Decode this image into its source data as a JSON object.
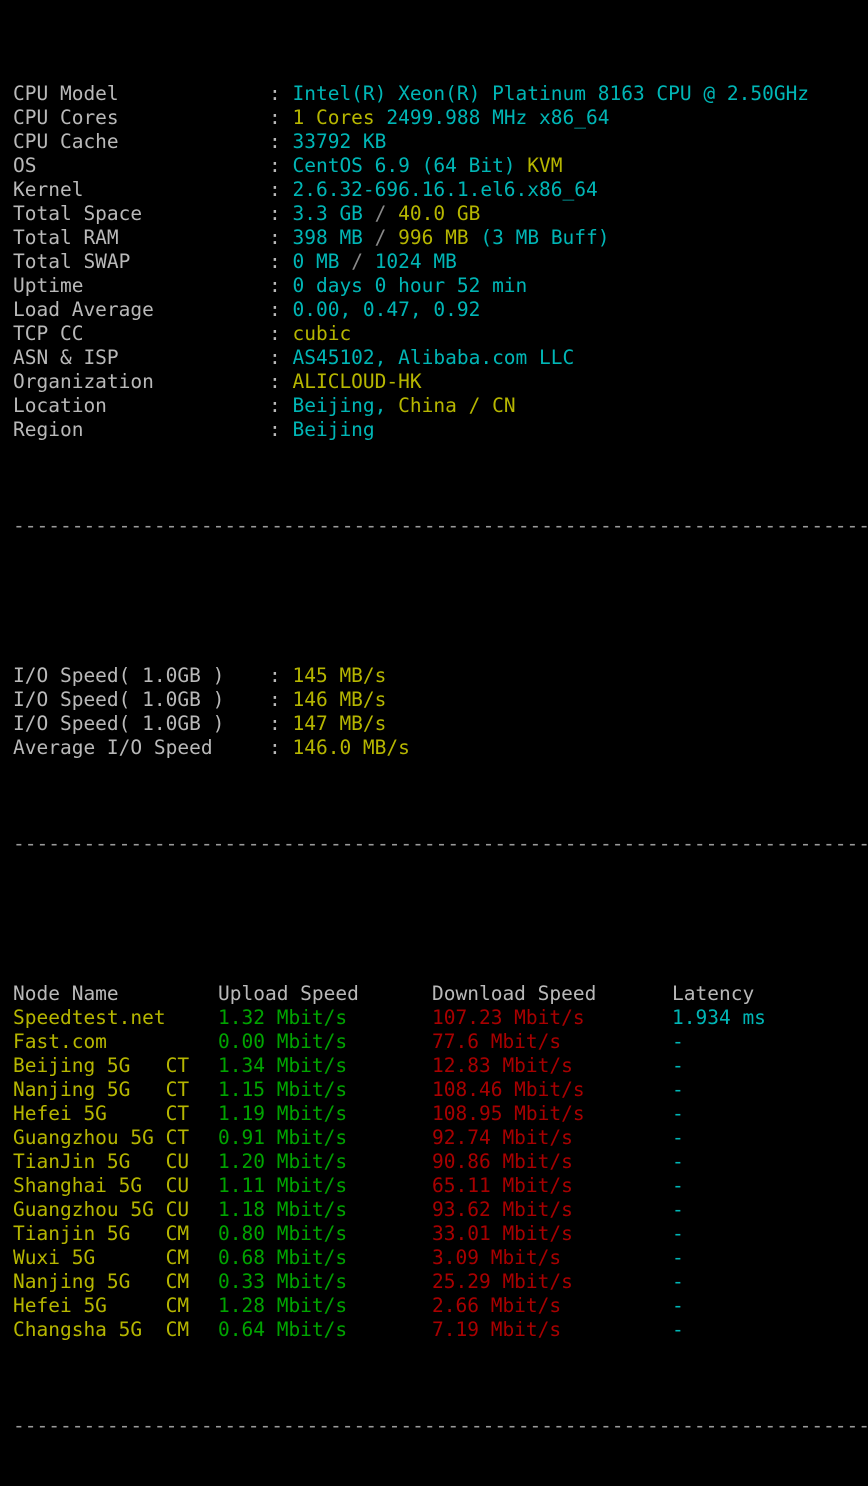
{
  "terminal": {
    "separator": "-------------------------------------------------------------------------------------------",
    "colon": ":"
  },
  "sysinfo": {
    "rows": [
      {
        "label": "CPU Model",
        "parts": [
          {
            "text": "Intel(R) Xeon(R) Platinum 8163 CPU @ 2.50GHz",
            "color": "cyan"
          }
        ]
      },
      {
        "label": "CPU Cores",
        "parts": [
          {
            "text": "1 Cores",
            "color": "yellow"
          },
          {
            "text": " ",
            "color": "gray"
          },
          {
            "text": "2499.988 MHz x86_64",
            "color": "cyan"
          }
        ]
      },
      {
        "label": "CPU Cache",
        "parts": [
          {
            "text": "33792 KB",
            "color": "cyan"
          }
        ]
      },
      {
        "label": "OS",
        "parts": [
          {
            "text": "CentOS 6.9 (64 Bit)",
            "color": "cyan"
          },
          {
            "text": " ",
            "color": "gray"
          },
          {
            "text": "KVM",
            "color": "yellow"
          }
        ]
      },
      {
        "label": "Kernel",
        "parts": [
          {
            "text": "2.6.32-696.16.1.el6.x86_64",
            "color": "cyan"
          }
        ]
      },
      {
        "label": "Total Space",
        "parts": [
          {
            "text": "3.3 GB",
            "color": "cyan"
          },
          {
            "text": " / ",
            "color": "gray"
          },
          {
            "text": "40.0 GB",
            "color": "yellow"
          }
        ]
      },
      {
        "label": "Total RAM",
        "parts": [
          {
            "text": "398 MB",
            "color": "cyan"
          },
          {
            "text": " / ",
            "color": "gray"
          },
          {
            "text": "996 MB",
            "color": "yellow"
          },
          {
            "text": " ",
            "color": "gray"
          },
          {
            "text": "(3 MB Buff)",
            "color": "cyan"
          }
        ]
      },
      {
        "label": "Total SWAP",
        "parts": [
          {
            "text": "0 MB",
            "color": "cyan"
          },
          {
            "text": " / ",
            "color": "gray"
          },
          {
            "text": "1024 MB",
            "color": "cyan"
          }
        ]
      },
      {
        "label": "Uptime",
        "parts": [
          {
            "text": "0 days 0 hour 52 min",
            "color": "cyan"
          }
        ]
      },
      {
        "label": "Load Average",
        "parts": [
          {
            "text": "0.00, 0.47, 0.92",
            "color": "cyan"
          }
        ]
      },
      {
        "label": "TCP CC",
        "parts": [
          {
            "text": "cubic",
            "color": "yellow"
          }
        ]
      },
      {
        "label": "ASN & ISP",
        "parts": [
          {
            "text": "AS45102, Alibaba.com LLC",
            "color": "cyan"
          }
        ]
      },
      {
        "label": "Organization",
        "parts": [
          {
            "text": "ALICLOUD-HK",
            "color": "yellow"
          }
        ]
      },
      {
        "label": "Location",
        "parts": [
          {
            "text": "Beijing,",
            "color": "cyan"
          },
          {
            "text": " ",
            "color": "gray"
          },
          {
            "text": "China / CN",
            "color": "yellow"
          }
        ]
      },
      {
        "label": "Region",
        "parts": [
          {
            "text": "Beijing",
            "color": "cyan"
          }
        ]
      }
    ]
  },
  "iotest": {
    "rows": [
      {
        "label": "I/O Speed( 1.0GB )",
        "value": "145 MB/s"
      },
      {
        "label": "I/O Speed( 1.0GB )",
        "value": "146 MB/s"
      },
      {
        "label": "I/O Speed( 1.0GB )",
        "value": "147 MB/s"
      },
      {
        "label": "Average I/O Speed",
        "value": "146.0 MB/s"
      }
    ]
  },
  "speedtest": {
    "headers": {
      "node": "Node Name",
      "upload": "Upload Speed",
      "download": "Download Speed",
      "latency": "Latency"
    },
    "rows": [
      {
        "node": "Speedtest.net",
        "upload": "1.32 Mbit/s",
        "download": "107.23 Mbit/s",
        "latency": "1.934 ms"
      },
      {
        "node": "Fast.com",
        "upload": "0.00 Mbit/s",
        "download": "77.6 Mbit/s",
        "latency": "-"
      },
      {
        "node": "Beijing 5G   CT",
        "upload": "1.34 Mbit/s",
        "download": "12.83 Mbit/s",
        "latency": "-"
      },
      {
        "node": "Nanjing 5G   CT",
        "upload": "1.15 Mbit/s",
        "download": "108.46 Mbit/s",
        "latency": "-"
      },
      {
        "node": "Hefei 5G     CT",
        "upload": "1.19 Mbit/s",
        "download": "108.95 Mbit/s",
        "latency": "-"
      },
      {
        "node": "Guangzhou 5G CT",
        "upload": "0.91 Mbit/s",
        "download": "92.74 Mbit/s",
        "latency": "-"
      },
      {
        "node": "TianJin 5G   CU",
        "upload": "1.20 Mbit/s",
        "download": "90.86 Mbit/s",
        "latency": "-"
      },
      {
        "node": "Shanghai 5G  CU",
        "upload": "1.11 Mbit/s",
        "download": "65.11 Mbit/s",
        "latency": "-"
      },
      {
        "node": "Guangzhou 5G CU",
        "upload": "1.18 Mbit/s",
        "download": "93.62 Mbit/s",
        "latency": "-"
      },
      {
        "node": "Tianjin 5G   CM",
        "upload": "0.80 Mbit/s",
        "download": "33.01 Mbit/s",
        "latency": "-"
      },
      {
        "node": "Wuxi 5G      CM",
        "upload": "0.68 Mbit/s",
        "download": "3.09 Mbit/s",
        "latency": "-"
      },
      {
        "node": "Nanjing 5G   CM",
        "upload": "0.33 Mbit/s",
        "download": "25.29 Mbit/s",
        "latency": "-"
      },
      {
        "node": "Hefei 5G     CM",
        "upload": "1.28 Mbit/s",
        "download": "2.66 Mbit/s",
        "latency": "-"
      },
      {
        "node": "Changsha 5G  CM",
        "upload": "0.64 Mbit/s",
        "download": "7.19 Mbit/s",
        "latency": "-"
      }
    ]
  },
  "colors": {
    "background": "#000000",
    "label": "#b9b9b9",
    "cyan": "#00b6b6",
    "yellow": "#b6b600",
    "green": "#00a400",
    "red": "#a80000",
    "separator": "#9a9a9a"
  }
}
